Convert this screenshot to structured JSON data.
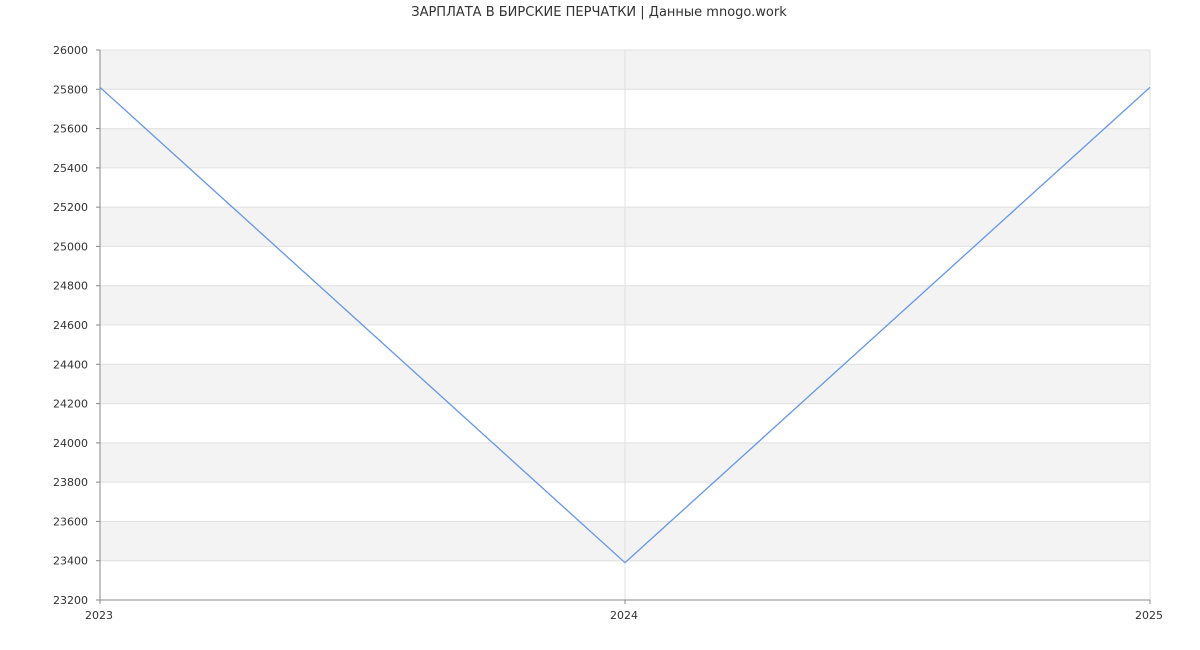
{
  "chart_data": {
    "type": "line",
    "title": "ЗАРПЛАТА В  БИРСКИЕ ПЕРЧАТКИ | Данные mnogo.work",
    "x": [
      "2023",
      "2024",
      "2025"
    ],
    "series": [
      {
        "values": [
          25810,
          23390,
          25810
        ]
      }
    ],
    "ylim": [
      23200,
      26000
    ],
    "yticks": [
      23200,
      23400,
      23600,
      23800,
      24000,
      24200,
      24400,
      24600,
      24800,
      25000,
      25200,
      25400,
      25600,
      25800,
      26000
    ],
    "grid": true,
    "colors": {
      "line": "#6495ed",
      "band": "#f3f3f3",
      "grid": "#e0e0e0",
      "axis": "#888888",
      "text": "#333333"
    }
  }
}
